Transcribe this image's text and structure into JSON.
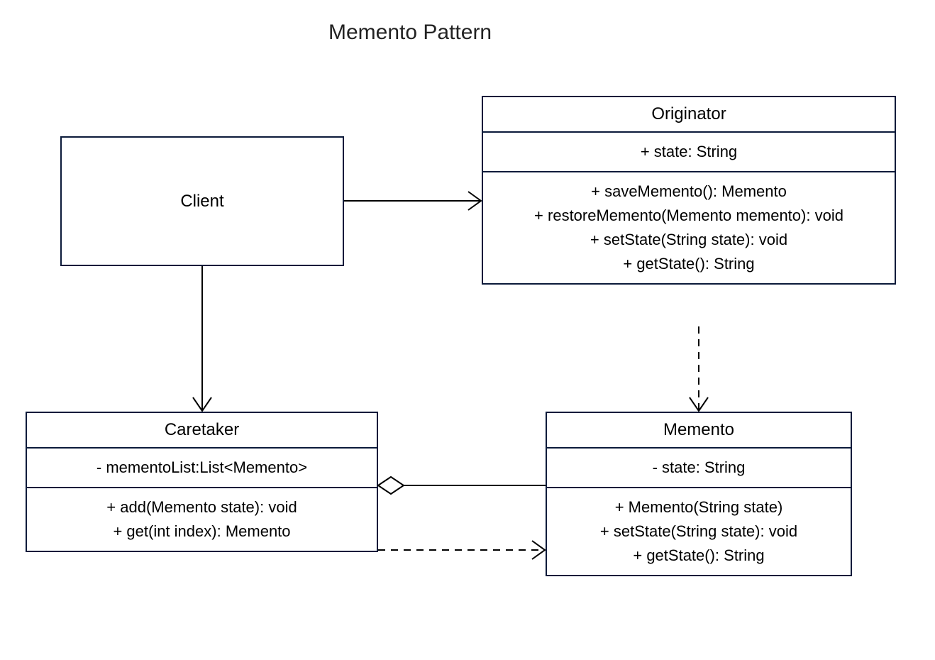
{
  "title": "Memento Pattern",
  "client": {
    "name": "Client"
  },
  "originator": {
    "name": "Originator",
    "attr1": "+    state: String",
    "op1": "+   saveMemento(): Memento",
    "op2": "+   restoreMemento(Memento memento): void",
    "op3": "+   setState(String state):  void",
    "op4": "+   getState(): String"
  },
  "caretaker": {
    "name": "Caretaker",
    "attr1": "-   mementoList:List<Memento>",
    "op1": "+   add(Memento state): void",
    "op2": "+   get(int index): Memento"
  },
  "memento": {
    "name": "Memento",
    "attr1": "-   state: String",
    "op1": "+   Memento(String state)",
    "op2": "+   setState(String state):  void",
    "op3": "+   getState(): String"
  }
}
